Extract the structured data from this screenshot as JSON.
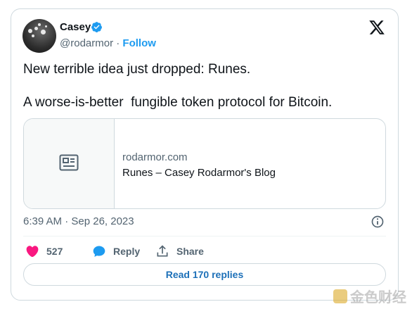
{
  "author": {
    "name": "Casey",
    "handle": "@rodarmor",
    "separator": "·",
    "follow_label": "Follow",
    "verified_color": "#1d9bf0",
    "avatar_icon": "avatar-photo"
  },
  "tweet": {
    "line1": "New terrible idea just dropped: Runes.",
    "line2": "A worse-is-better  fungible token protocol for Bitcoin."
  },
  "link_card": {
    "icon": "article-icon",
    "domain": "rodarmor.com",
    "title": "Runes – Casey Rodarmor's Blog"
  },
  "timestamp": "6:39 AM · Sep 26, 2023",
  "actions": {
    "like_count": "527",
    "like_color": "#f91880",
    "reply_label": "Reply",
    "reply_color": "#1d9bf0",
    "share_label": "Share"
  },
  "read_replies_label": "Read 170 replies",
  "watermark": {
    "text": "金色财经"
  },
  "colors": {
    "accent": "#1d9bf0",
    "text_secondary": "#536471",
    "border": "#cfd9de"
  }
}
